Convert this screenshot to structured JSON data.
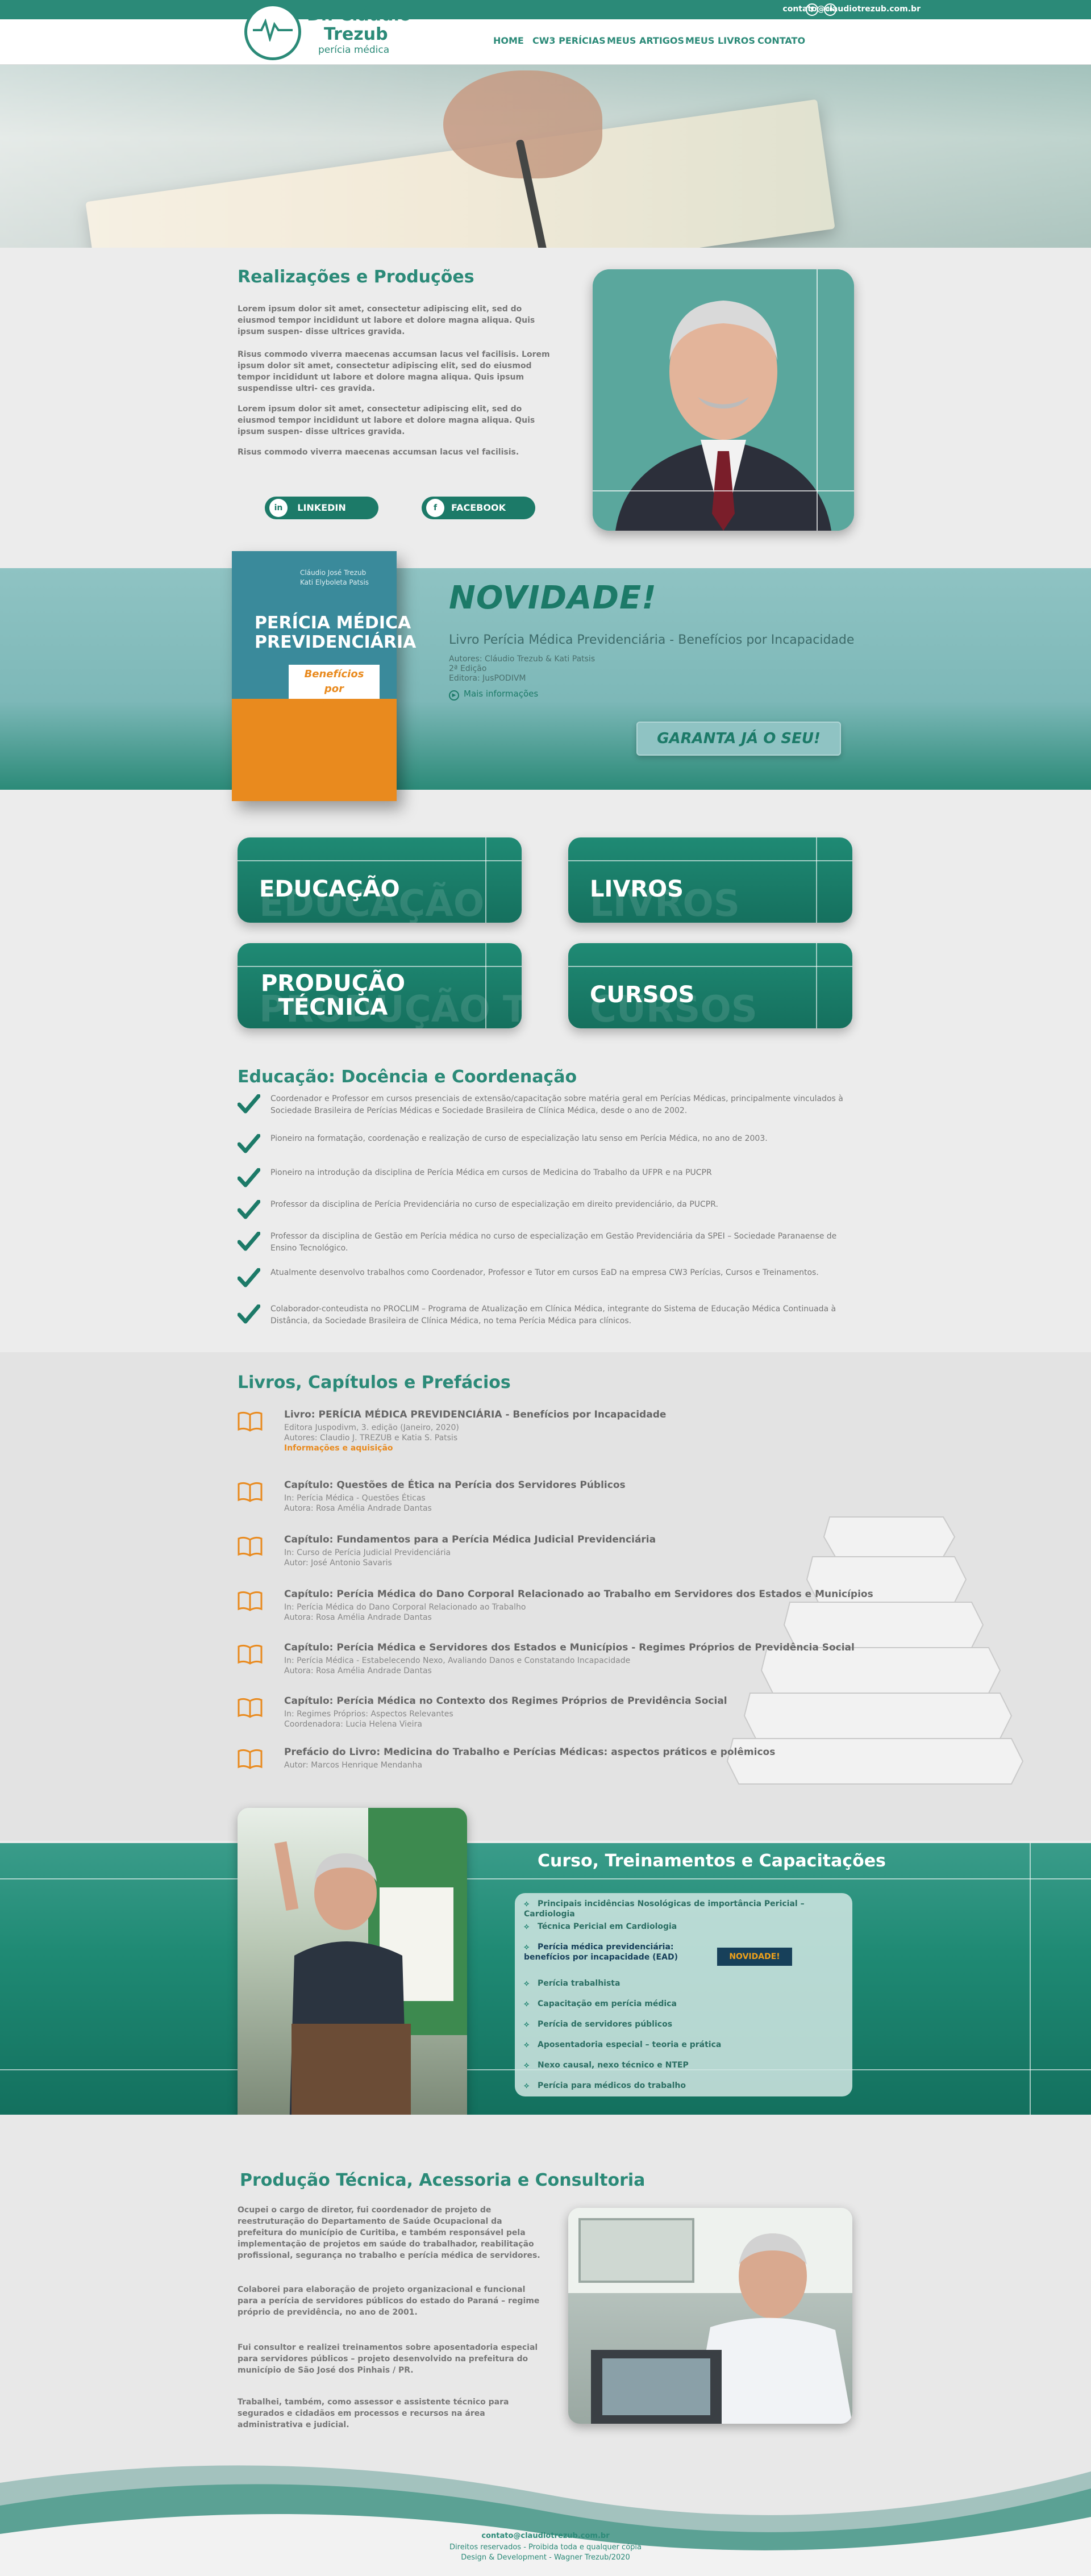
{
  "header": {
    "email": "contato@claudiotrezub.com.br",
    "social": [
      {
        "icon": "facebook-icon",
        "glyph": "f"
      },
      {
        "icon": "linkedin-icon",
        "glyph": "in"
      }
    ],
    "logo": {
      "line1": "Dr. Cláudio",
      "line2": "Trezub",
      "sub": "perícia médica"
    },
    "nav": [
      "HOME",
      "CW3 PERÍCIAS",
      "MEUS ARTIGOS",
      "MEUS LIVROS",
      "CONTATO"
    ]
  },
  "realizacoes": {
    "title": "Realizações e Produções",
    "p1": "Lorem ipsum dolor sit amet, consectetur adipiscing elit, sed do eiusmod tempor incididunt ut labore et dolore magna aliqua. Quis ipsum suspen- disse ultrices gravida.",
    "p2": "Risus commodo viverra maecenas accumsan lacus vel facilisis. Lorem ipsum dolor sit amet, consectetur adipiscing elit, sed do eiusmod tempor incididunt ut labore et dolore magna aliqua. Quis ipsum suspendisse ultri- ces gravida.",
    "p3": "Lorem ipsum dolor sit amet, consectetur adipiscing elit, sed do eiusmod tempor incididunt ut labore et dolore magna aliqua. Quis ipsum suspen- disse ultrices gravida.",
    "p4": "Risus commodo viverra maecenas accumsan lacus vel facilisis.",
    "linkedin": "LINKEDIN",
    "facebook": "FACEBOOK"
  },
  "novidade": {
    "heading": "NOVIDADE!",
    "book_title": "Livro Perícia Médica Previdenciária - Benefícios por Incapacidade",
    "authors": "Autores: Cláudio Trezub & Kati Patsis",
    "edition": "2ª Edição",
    "publisher": "Editora: JusPODIVM",
    "more": "Mais informações",
    "cta": "GARANTA JÁ O SEU!",
    "cover": {
      "line1": "PERÍCIA MÉDICA",
      "line2": "PREVIDENCIÁRIA",
      "sub1": "Benefícios",
      "sub2": "por Incapacidade",
      "top": "Cláudio José Trezub",
      "top2": "Kati Elyboleta Patsis"
    }
  },
  "tiles": [
    "EDUCAÇÃO",
    "LIVROS",
    "PRODUÇÃO TÉCNICA",
    "CURSOS"
  ],
  "educacao": {
    "title": "Educação: Docência e Coordenação",
    "items": [
      "Coordenador e Professor em cursos presenciais de extensão/capacitação sobre matéria geral em Perícias Médicas, principalmente vinculados à Sociedade Brasileira de Perícias Médicas e Sociedade Brasileira de Clínica Médica, desde o ano de 2002.",
      "Pioneiro na formatação, coordenação e realização de curso de especialização latu senso em Perícia Médica, no ano de 2003.",
      "Pioneiro na introdução da disciplina de Perícia Médica em cursos de Medicina do Trabalho da UFPR e na PUCPR",
      "Professor da disciplina de Perícia Previdenciária no curso de especialização em direito previdenciário, da PUCPR.",
      "Professor da disciplina de Gestão em Perícia médica no curso de especialização em Gestão Previdenciária da SPEI – Sociedade Paranaense de Ensino Tecnológico.",
      "Atualmente desenvolvo trabalhos como Coordenador, Professor e Tutor em cursos EaD na empresa CW3 Perícias, Cursos e Treinamentos.",
      "Colaborador-conteudista no PROCLIM – Programa de Atualização em Clínica Médica, integrante do Sistema de Educação Médica Continuada à Distância, da Sociedade Brasileira de Clínica Médica, no tema Perícia Médica para clínicos."
    ]
  },
  "livros": {
    "title": "Livros, Capítulos e Prefácios",
    "items": [
      {
        "title": "Livro: PERÍCIA MÉDICA PREVIDENCIÁRIA - Benefícios por Incapacidade",
        "l1": "Editora Juspodivm, 3. edição (Janeiro, 2020)",
        "l2": "Autores: Claudio J. TREZUB e Katia S. Patsis",
        "l3": "Informações e aquisição"
      },
      {
        "title": "Capítulo: Questões de Ética na Perícia dos Servidores Públicos",
        "l1": "In: Perícia Médica - Questões Éticas",
        "l2": "Autora: Rosa Amélia Andrade Dantas",
        "l3": ""
      },
      {
        "title": "Capítulo: Fundamentos para a Perícia Médica Judicial Previdenciária",
        "l1": "In: Curso de Perícia Judicial Previdenciária",
        "l2": "Autor: José Antonio Savaris",
        "l3": ""
      },
      {
        "title": "Capítulo: Perícia Médica do Dano Corporal Relacionado ao Trabalho em Servidores dos Estados e Municípios",
        "l1": "In: Perícia Médica do Dano Corporal Relacionado ao Trabalho",
        "l2": "Autora: Rosa Amélia Andrade Dantas",
        "l3": ""
      },
      {
        "title": "Capítulo: Perícia Médica e Servidores dos Estados e Municípios - Regimes Próprios de Previdência Social",
        "l1": "In: Perícia Médica - Estabelecendo Nexo, Avaliando Danos e Constatando Incapacidade",
        "l2": "Autora: Rosa Amélia Andrade Dantas",
        "l3": ""
      },
      {
        "title": "Capítulo: Perícia Médica no Contexto dos Regimes Próprios de Previdência Social",
        "l1": "In: Regimes Próprios: Aspectos Relevantes",
        "l2": "Coordenadora: Lucia Helena Vieira",
        "l3": ""
      },
      {
        "title": "Prefácio do Livro: Medicina do Trabalho e Perícias Médicas: aspectos práticos e polêmicos",
        "l1": "Autor: Marcos Henrique Mendanha",
        "l2": "",
        "l3": ""
      }
    ]
  },
  "curso": {
    "title": "Curso, Treinamentos e Capacitações",
    "items": [
      "Principais incidências Nosológicas de importância Pericial – Cardiologia",
      "Técnica Pericial em Cardiologia",
      "Perícia médica previdenciária: benefícios por incapacidade (EAD)",
      "Perícia trabalhista",
      "Capacitação em perícia médica",
      "Perícia de servidores públicos",
      "Aposentadoria especial – teoria e prática",
      "Nexo causal, nexo técnico e NTEP",
      "Perícia para médicos do trabalho"
    ],
    "badge": "NOVIDADE!"
  },
  "producao": {
    "title": "Produção Técnica, Acessoria e Consultoria",
    "p1": "Ocupei o cargo de diretor, fui coordenador de projeto de reestruturação do Departamento de Saúde Ocupacional da prefeitura do município de Curitiba, e também responsável pela implementação de projetos em saúde do trabalhador, reabilitação profissional, segurança no trabalho e perícia médica de servidores.",
    "p2": "Colaborei para elaboração de projeto organizacional e funcional para a perícia de servidores públicos do estado do Paraná – regime próprio de previdência, no ano de 2001.",
    "p3": "Fui consultor e realizei treinamentos sobre aposentadoria especial para servidores públicos – projeto desenvolvido na prefeitura do município de São José dos Pinhais / PR.",
    "p4": "Trabalhei, também, como assessor e assistente técnico para segurados e cidadãos em processos e recursos na área administrativa e judicial."
  },
  "footer": {
    "email": "contato@claudiotrezub.com.br",
    "rights": "Direitos reservados - Proibida toda e qualquer cópia",
    "dev": "Design & Development - Wagner Trezub/2020"
  },
  "colors": {
    "primary": "#2b8a78",
    "dark": "#15705e",
    "orange": "#e98a1e"
  }
}
